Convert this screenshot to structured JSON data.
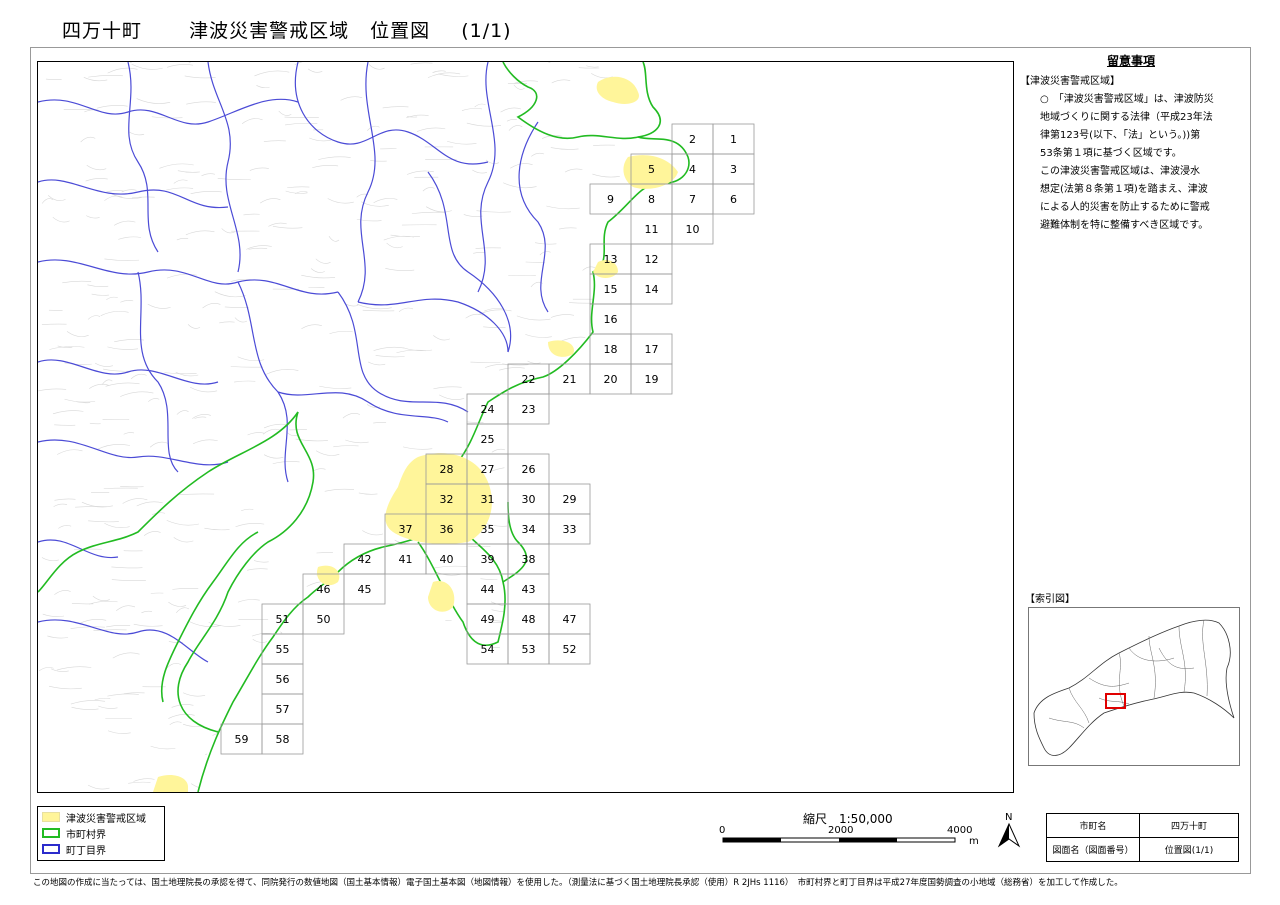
{
  "title": {
    "town": "四万十町",
    "zone": "津波災害警戒区域",
    "kind": "位置図",
    "page": "(1/1)"
  },
  "notes": {
    "heading": "留意事項",
    "section": "【津波災害警戒区域】",
    "para1_lines": [
      "○　「津波災害警戒区域」は、津波防災",
      "地域づくりに関する法律（平成23年法",
      "律第123号(以下、「法」という。))第",
      "53条第１項に基づく区域です。"
    ],
    "para2_lines": [
      "この津波災害警戒区域は、津波浸水",
      "想定(法第８条第１項)を踏まえ、津波",
      "による人的災害を防止するために警戒",
      "避難体制を特に整備すべき区域です。"
    ]
  },
  "index_map": {
    "label": "【索引図】",
    "highlight_color": "#e00000"
  },
  "legend": {
    "items": [
      {
        "label": "津波災害警戒区域",
        "color": "#fff59a",
        "kind": "fill"
      },
      {
        "label": "市町村界",
        "color": "#22bb22",
        "kind": "line"
      },
      {
        "label": "町丁目界",
        "color": "#2b2bcc",
        "kind": "line"
      }
    ]
  },
  "scale": {
    "title": "縮尺　1:50,000",
    "ticks": [
      "0",
      "2000",
      "4000"
    ],
    "unit": "m"
  },
  "north": {
    "label": "N"
  },
  "info_table": {
    "rows": [
      {
        "key": "市町名",
        "value": "四万十町"
      },
      {
        "key": "図面名（図面番号）",
        "value": "位置図(1/1)"
      }
    ]
  },
  "footer": "この地図の作成に当たっては、国土地理院長の承認を得て、同院発行の数値地図（国土基本情報）電子国土基本図（地図情報）を使用した。（測量法に基づく国土地理院長承認（使用）R 2JHs 1116）　市町村界と町丁目界は平成27年度国勢調査の小地域（総務省）を加工して作成した。",
  "colors": {
    "municipal_boundary": "#22bb22",
    "district_boundary": "#4b4bd6",
    "tsunami_zone": "#fff59a",
    "terrain": "#d6d6d6",
    "grid": "#9a9a9a"
  },
  "grid_cells": [
    {
      "id": "1",
      "col": 15,
      "row": 0
    },
    {
      "id": "2",
      "col": 14,
      "row": 0
    },
    {
      "id": "3",
      "col": 15,
      "row": 1
    },
    {
      "id": "4",
      "col": 14,
      "row": 1
    },
    {
      "id": "5",
      "col": 13,
      "row": 1
    },
    {
      "id": "6",
      "col": 15,
      "row": 2
    },
    {
      "id": "7",
      "col": 14,
      "row": 2
    },
    {
      "id": "8",
      "col": 13,
      "row": 2
    },
    {
      "id": "9",
      "col": 12,
      "row": 2
    },
    {
      "id": "10",
      "col": 14,
      "row": 3
    },
    {
      "id": "11",
      "col": 13,
      "row": 3
    },
    {
      "id": "12",
      "col": 13,
      "row": 4
    },
    {
      "id": "13",
      "col": 12,
      "row": 4
    },
    {
      "id": "14",
      "col": 13,
      "row": 5
    },
    {
      "id": "15",
      "col": 12,
      "row": 5
    },
    {
      "id": "16",
      "col": 12,
      "row": 6
    },
    {
      "id": "17",
      "col": 13,
      "row": 7
    },
    {
      "id": "18",
      "col": 12,
      "row": 7
    },
    {
      "id": "19",
      "col": 13,
      "row": 8
    },
    {
      "id": "20",
      "col": 12,
      "row": 8
    },
    {
      "id": "21",
      "col": 11,
      "row": 8
    },
    {
      "id": "22",
      "col": 10,
      "row": 8
    },
    {
      "id": "23",
      "col": 10,
      "row": 9
    },
    {
      "id": "24",
      "col": 9,
      "row": 9
    },
    {
      "id": "25",
      "col": 9,
      "row": 10
    },
    {
      "id": "26",
      "col": 10,
      "row": 11
    },
    {
      "id": "27",
      "col": 9,
      "row": 11
    },
    {
      "id": "28",
      "col": 8,
      "row": 11
    },
    {
      "id": "29",
      "col": 11,
      "row": 12
    },
    {
      "id": "30",
      "col": 10,
      "row": 12
    },
    {
      "id": "31",
      "col": 9,
      "row": 12
    },
    {
      "id": "32",
      "col": 8,
      "row": 12
    },
    {
      "id": "33",
      "col": 11,
      "row": 13
    },
    {
      "id": "34",
      "col": 10,
      "row": 13
    },
    {
      "id": "35",
      "col": 9,
      "row": 13
    },
    {
      "id": "36",
      "col": 8,
      "row": 13
    },
    {
      "id": "37",
      "col": 7,
      "row": 13
    },
    {
      "id": "38",
      "col": 10,
      "row": 14
    },
    {
      "id": "39",
      "col": 9,
      "row": 14
    },
    {
      "id": "40",
      "col": 8,
      "row": 14
    },
    {
      "id": "41",
      "col": 7,
      "row": 14
    },
    {
      "id": "42",
      "col": 6,
      "row": 14
    },
    {
      "id": "43",
      "col": 10,
      "row": 15
    },
    {
      "id": "44",
      "col": 9,
      "row": 15
    },
    {
      "id": "45",
      "col": 6,
      "row": 15
    },
    {
      "id": "46",
      "col": 5,
      "row": 15
    },
    {
      "id": "47",
      "col": 11,
      "row": 16
    },
    {
      "id": "48",
      "col": 10,
      "row": 16
    },
    {
      "id": "49",
      "col": 9,
      "row": 16
    },
    {
      "id": "50",
      "col": 5,
      "row": 16
    },
    {
      "id": "51",
      "col": 4,
      "row": 16
    },
    {
      "id": "52",
      "col": 11,
      "row": 17
    },
    {
      "id": "53",
      "col": 10,
      "row": 17
    },
    {
      "id": "54",
      "col": 9,
      "row": 17
    },
    {
      "id": "55",
      "col": 4,
      "row": 17
    },
    {
      "id": "56",
      "col": 4,
      "row": 18
    },
    {
      "id": "57",
      "col": 4,
      "row": 19
    },
    {
      "id": "58",
      "col": 4,
      "row": 20
    },
    {
      "id": "59",
      "col": 3,
      "row": 20
    }
  ]
}
